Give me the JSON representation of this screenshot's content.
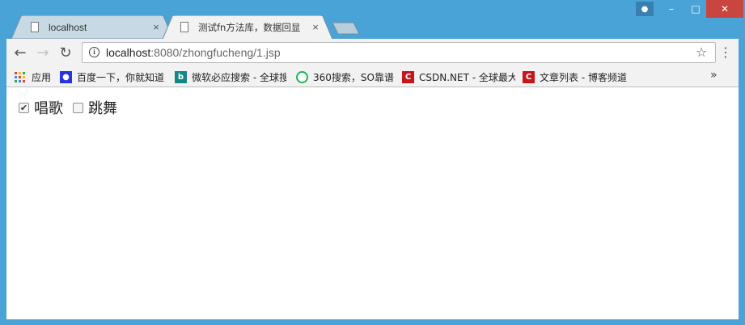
{
  "tabs": [
    {
      "title": "localhost",
      "close": "×"
    },
    {
      "title": "测试fn方法库，数据回显",
      "close": "×"
    }
  ],
  "toolbar": {
    "back": "←",
    "forward": "→",
    "reload": "↻",
    "info": "i",
    "url_host": "localhost",
    "url_rest": ":8080/zhongfucheng/1.jsp",
    "star": "☆",
    "menu": "⋮"
  },
  "window_controls": {
    "minimize": "–",
    "maximize": "□",
    "close": "✕"
  },
  "bookmarks": [
    {
      "label": "应用",
      "icon": "apps-grid-icon"
    },
    {
      "label": "百度一下，你就知道",
      "icon": "baidu-paw-icon",
      "color": "#2932e1"
    },
    {
      "label": "微软必应搜索 - 全球搜",
      "icon": "bing-icon",
      "color": "#138784"
    },
    {
      "label": "360搜索，SO靠谱",
      "icon": "360-search-icon",
      "color": "#19b955"
    },
    {
      "label": "CSDN.NET - 全球最大",
      "icon": "csdn-icon",
      "color": "#c5161d"
    },
    {
      "label": "文章列表 - 博客频道",
      "icon": "csdn-icon",
      "color": "#c5161d"
    }
  ],
  "bookmarks_more": "»",
  "page": {
    "checkboxes": [
      {
        "label": "唱歌",
        "checked": true,
        "mark": "✔"
      },
      {
        "label": "跳舞",
        "checked": false,
        "mark": ""
      }
    ]
  },
  "colors": {
    "frame": "#4aa3d6",
    "close_button": "#c9453f",
    "active_tab": "#f2f2f2",
    "inactive_tab": "#c7d9e4"
  }
}
